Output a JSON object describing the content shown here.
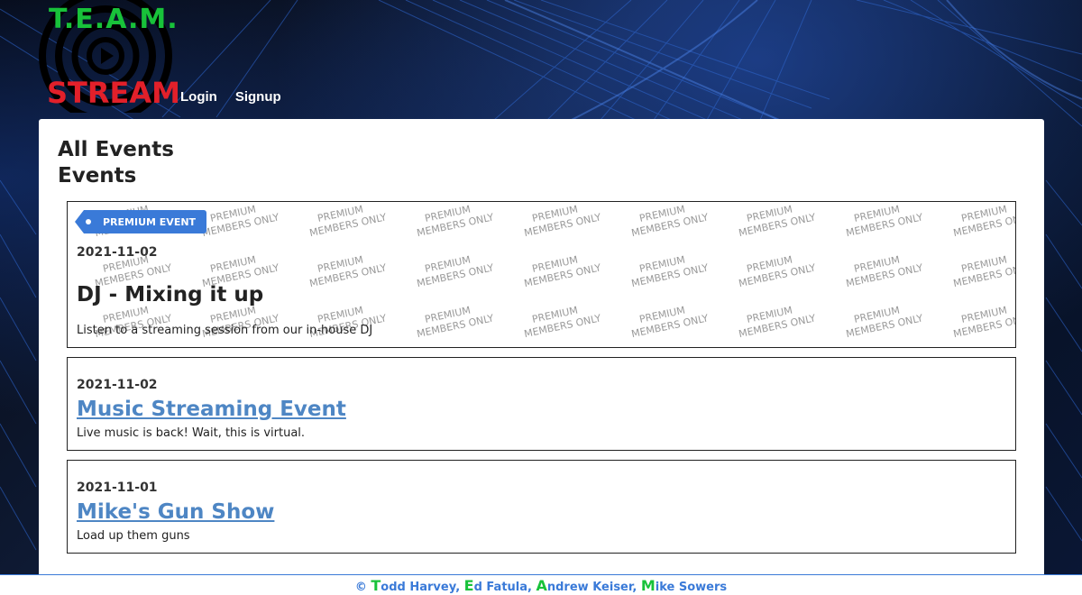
{
  "brand": {
    "line1": "T.E.A.M.",
    "line2": "STREAM",
    "colors": {
      "green": "#18c23a",
      "red": "#e2202a"
    }
  },
  "nav": {
    "login": "Login",
    "signup": "Signup"
  },
  "main": {
    "page_title": "All Events",
    "section_title": "Events"
  },
  "premium_badge": "PREMIUM EVENT",
  "watermark": {
    "line1": "PREMIUM",
    "line2": "MEMBERS ONLY"
  },
  "events": [
    {
      "date": "2021-11-02",
      "title": "DJ - Mixing it up",
      "description": "Listen to a streaming session from our in-house DJ",
      "premium": true
    },
    {
      "date": "2021-11-02",
      "title": "Music Streaming Event",
      "description": "Live music is back! Wait, this is virtual.",
      "premium": false
    },
    {
      "date": "2021-11-01",
      "title": "Mike's Gun Show",
      "description": "Load up them guns",
      "premium": false
    }
  ],
  "footer": {
    "copyright": "©",
    "authors": [
      {
        "initial": "T",
        "rest": "odd Harvey"
      },
      {
        "initial": "E",
        "rest": "d Fatula"
      },
      {
        "initial": "A",
        "rest": "ndrew Keiser"
      },
      {
        "initial": "M",
        "rest": "ike Sowers"
      }
    ]
  },
  "colors": {
    "accent": "#3a7ad8",
    "link": "#4e86c4",
    "panel": "#ffffff"
  }
}
